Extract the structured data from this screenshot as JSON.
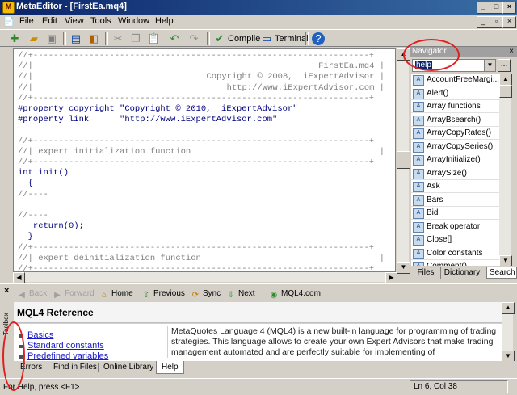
{
  "window": {
    "title": "MetaEditor - [FirstEa.mq4]"
  },
  "menu": [
    "File",
    "Edit",
    "View",
    "Tools",
    "Window",
    "Help"
  ],
  "toolbar": {
    "compile_label": "Compile",
    "terminal_label": "Terminal"
  },
  "editor": {
    "lines": [
      {
        "left": "//+------------------------------------------------------------------+",
        "right": ""
      },
      {
        "left": "//|",
        "right": "FirstEa.mq4 |"
      },
      {
        "left": "//|",
        "right": "Copyright © 2008,  iExpertAdvisor |"
      },
      {
        "left": "//|",
        "right": "http://www.iExpertAdvisor.com |"
      },
      {
        "left": "//+------------------------------------------------------------------+",
        "right": ""
      },
      {
        "left": "#property copyright \"Copyright © 2010,  iExpertAdvisor\"",
        "right": ""
      },
      {
        "left": "#property link      \"http://www.iExpertAdvisor.com\"",
        "right": ""
      },
      {
        "left": "",
        "right": ""
      },
      {
        "left": "//+------------------------------------------------------------------+",
        "right": ""
      },
      {
        "left": "//| expert initialization function",
        "right": "|"
      },
      {
        "left": "//+------------------------------------------------------------------+",
        "right": ""
      },
      {
        "left": "int init()",
        "right": ""
      },
      {
        "left": "  {",
        "right": ""
      },
      {
        "left": "//----",
        "right": ""
      },
      {
        "left": "",
        "right": ""
      },
      {
        "left": "//----",
        "right": ""
      },
      {
        "left": "   return(0);",
        "right": ""
      },
      {
        "left": "  }",
        "right": ""
      },
      {
        "left": "//+------------------------------------------------------------------+",
        "right": ""
      },
      {
        "left": "//| expert deinitialization function",
        "right": "|"
      },
      {
        "left": "//+------------------------------------------------------------------+",
        "right": ""
      }
    ]
  },
  "navigator": {
    "title": "Navigator",
    "search_value": "help",
    "more_label": "...",
    "items": [
      "AccountFreeMargi...",
      "Alert()",
      "Array functions",
      "ArrayBsearch()",
      "ArrayCopyRates()",
      "ArrayCopySeries()",
      "ArrayInitialize()",
      "ArraySize()",
      "Ask",
      "Bars",
      "Bid",
      "Break operator",
      "Close[]",
      "Color constants",
      "Comment()"
    ],
    "tabs": [
      "Files",
      "Dictionary",
      "Search"
    ]
  },
  "toolbox": {
    "close_label": "×",
    "side_label": "Toolbox",
    "nav": {
      "back": "Back",
      "forward": "Forward",
      "home": "Home",
      "previous": "Previous",
      "sync": "Sync",
      "next": "Next",
      "mql4": "MQL4.com"
    },
    "help_title": "MQL4 Reference",
    "links": [
      "Basics",
      "Standard constants",
      "Predefined variables"
    ],
    "description": "MetaQuotes Language 4 (MQL4) is a new built-in language for programming of trading strategies. This language allows to create your own Expert Advisors that make trading management automated and are perfectly suitable for implementing of",
    "tabs": [
      "Errors",
      "Find in Files",
      "Online Library",
      "Help"
    ]
  },
  "status": {
    "text": "For Help, press <F1>",
    "position": "Ln 6, Col 38"
  },
  "colors": {
    "titlebar": "#0a246a",
    "annotation": "#e02020",
    "code_blue": "#000080",
    "code_teal": "#008080"
  }
}
